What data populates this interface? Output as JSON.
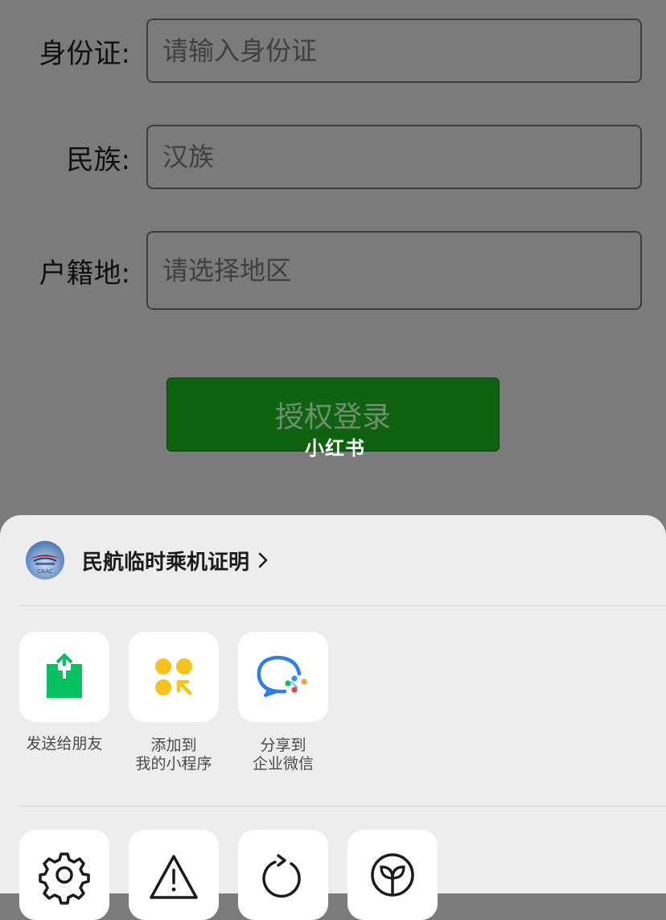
{
  "form": {
    "id_label": "身份证:",
    "id_placeholder": "请输入身份证",
    "ethnicity_label": "民族:",
    "ethnicity_placeholder": "汉族",
    "hukou_label": "户籍地:",
    "hukou_placeholder": "请选择地区",
    "login_button": "授权登录"
  },
  "watermark": "小红书",
  "sheet": {
    "app_name": "民航临时乘机证明",
    "app_logo_text": "CAAC",
    "share_actions": [
      {
        "icon": "share-upload-icon",
        "label_line1": "发送给朋友",
        "label_line2": ""
      },
      {
        "icon": "add-mini-program-icon",
        "label_line1": "添加到",
        "label_line2": "我的小程序"
      },
      {
        "icon": "wecom-icon",
        "label_line1": "分享到",
        "label_line2": "企业微信"
      }
    ],
    "utility_actions": [
      {
        "icon": "settings-gear-icon"
      },
      {
        "icon": "warning-complain-icon"
      },
      {
        "icon": "reload-icon"
      },
      {
        "icon": "sprout-leaf-icon"
      }
    ]
  },
  "colors": {
    "overlay_bg": "#7b7b7b",
    "login_button": "#0f620f",
    "sheet_bg": "#ededed",
    "share_green": "#07c160",
    "mini_program_yellow": "#f7c31b",
    "wecom_blue": "#2a80e8"
  }
}
